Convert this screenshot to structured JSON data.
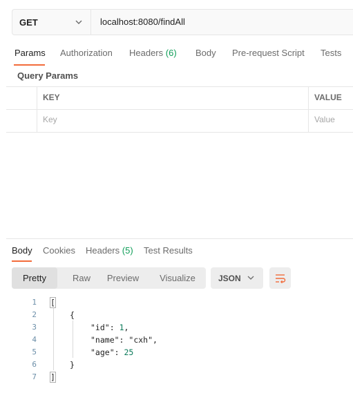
{
  "request": {
    "method": "GET",
    "url": "localhost:8080/findAll"
  },
  "request_tabs": [
    {
      "label": "Params"
    },
    {
      "label": "Authorization"
    },
    {
      "label": "Headers",
      "count": "(6)"
    },
    {
      "label": "Body"
    },
    {
      "label": "Pre-request Script"
    },
    {
      "label": "Tests"
    }
  ],
  "query_params": {
    "title": "Query Params",
    "columns": [
      "KEY",
      "VALUE"
    ],
    "placeholders": {
      "key": "Key",
      "value": "Value"
    }
  },
  "response_tabs": [
    {
      "label": "Body"
    },
    {
      "label": "Cookies"
    },
    {
      "label": "Headers",
      "count": "(5)"
    },
    {
      "label": "Test Results"
    }
  ],
  "view_modes": [
    "Pretty",
    "Raw",
    "Preview",
    "Visualize"
  ],
  "format": "JSON",
  "code": {
    "line_numbers": [
      "1",
      "2",
      "3",
      "4",
      "5",
      "6",
      "7"
    ],
    "lines": [
      {
        "text": "["
      },
      {
        "text": "{"
      },
      {
        "key": "\"id\"",
        "sep": ": ",
        "val": "1",
        "tail": ","
      },
      {
        "key": "\"name\"",
        "sep": ": ",
        "val": "\"cxh\"",
        "tail": ","
      },
      {
        "key": "\"age\"",
        "sep": ": ",
        "val": "25",
        "tail": ""
      },
      {
        "text": "}"
      },
      {
        "text": "]"
      }
    ]
  },
  "colors": {
    "accent": "#f26b3a",
    "count": "#0f9d58"
  }
}
